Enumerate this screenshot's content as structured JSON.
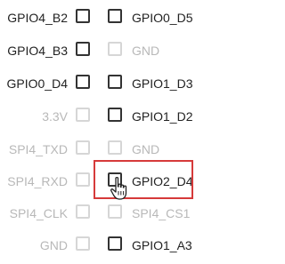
{
  "rows": [
    {
      "left": {
        "label": "GPIO4_B2",
        "enabled": true
      },
      "right": {
        "label": "GPIO0_D5",
        "enabled": true
      }
    },
    {
      "left": {
        "label": "GPIO4_B3",
        "enabled": true
      },
      "right": {
        "label": "GND",
        "enabled": false
      }
    },
    {
      "left": {
        "label": "GPIO0_D4",
        "enabled": true
      },
      "right": {
        "label": "GPIO1_D3",
        "enabled": true
      }
    },
    {
      "left": {
        "label": "3.3V",
        "enabled": false
      },
      "right": {
        "label": "GPIO1_D2",
        "enabled": true
      }
    },
    {
      "left": {
        "label": "SPI4_TXD",
        "enabled": false
      },
      "right": {
        "label": "GND",
        "enabled": false
      }
    },
    {
      "left": {
        "label": "SPI4_RXD",
        "enabled": false
      },
      "right": {
        "label": "GPIO2_D4",
        "enabled": true
      }
    },
    {
      "left": {
        "label": "SPI4_CLK",
        "enabled": false
      },
      "right": {
        "label": "SPI4_CS1",
        "enabled": false
      }
    },
    {
      "left": {
        "label": "GND",
        "enabled": false
      },
      "right": {
        "label": "GPIO1_A3",
        "enabled": true
      }
    }
  ],
  "highlight": {
    "pin": "GPIO2_D4",
    "color": "#d63a3a"
  },
  "cursor": {
    "icon": "hand-pointer-icon"
  },
  "colors": {
    "enabled_text": "#222222",
    "disabled_text": "#b8b8b8",
    "enabled_box": "#333333",
    "disabled_box": "#d6d6d6"
  }
}
